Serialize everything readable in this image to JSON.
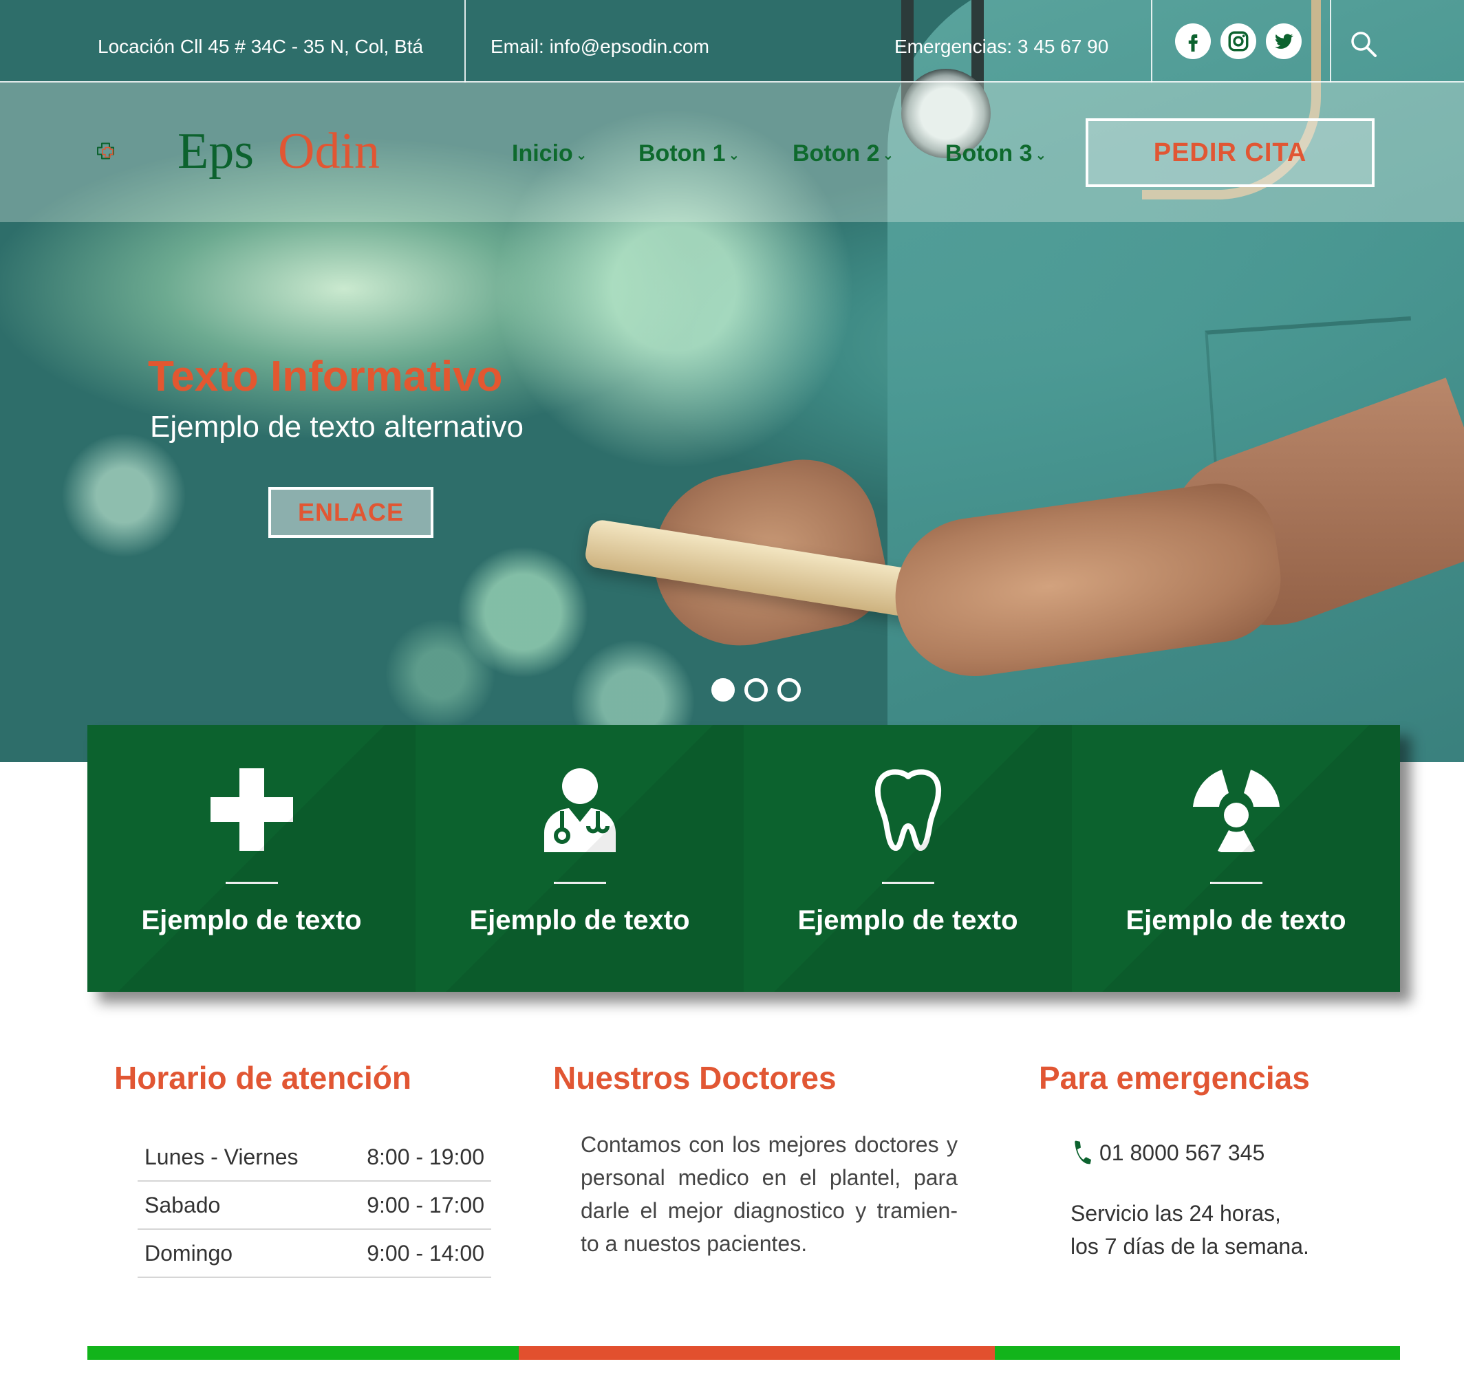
{
  "colors": {
    "brand_green": "#0c622e",
    "accent_orange": "#e15633",
    "stripe_green": "#12b41b",
    "stripe_orange": "#e2502e"
  },
  "topbar": {
    "location": "Locación Cll 45 # 34C - 35 N, Col, Btá",
    "email": "Email: info@epsodin.com",
    "emergency": "Emergencias: 3 45 67 90",
    "social": [
      "facebook-icon",
      "instagram-icon",
      "twitter-icon"
    ],
    "search_icon": "search-icon"
  },
  "brand": {
    "name_part1": "Eps",
    "name_part2": "Odin"
  },
  "nav": {
    "items": [
      {
        "label": "Inicio"
      },
      {
        "label": "Boton 1"
      },
      {
        "label": "Boton 2"
      },
      {
        "label": "Boton 3"
      }
    ],
    "cta_label": "PEDIR CITA"
  },
  "hero": {
    "title": "Texto Informativo",
    "subtitle": "Ejemplo de texto alternativo",
    "link_label": "ENLACE",
    "slides": 3,
    "active_slide": 1
  },
  "services": [
    {
      "icon": "medical-cross-icon",
      "label": "Ejemplo de texto"
    },
    {
      "icon": "doctor-icon",
      "label": "Ejemplo de texto"
    },
    {
      "icon": "tooth-icon",
      "label": "Ejemplo de texto"
    },
    {
      "icon": "radiation-icon",
      "label": "Ejemplo de texto"
    }
  ],
  "hours": {
    "title": "Horario de atención",
    "rows": [
      {
        "day": "Lunes - Viernes",
        "time": "8:00 - 19:00"
      },
      {
        "day": "Sabado",
        "time": "9:00 - 17:00"
      },
      {
        "day": "Domingo",
        "time": "9:00 - 14:00"
      }
    ]
  },
  "doctors": {
    "title": "Nuestros Doctores",
    "text": "Contamos con los mejores doctores y personal medico en el plantel, para darle el mejor diagnostico y tramien- to a nuestos pacientes."
  },
  "emergencies": {
    "title": "Para emergencias",
    "phone": "01 8000 567 345",
    "line1": "Servicio las 24 horas,",
    "line2": "los 7 días de la semana."
  }
}
